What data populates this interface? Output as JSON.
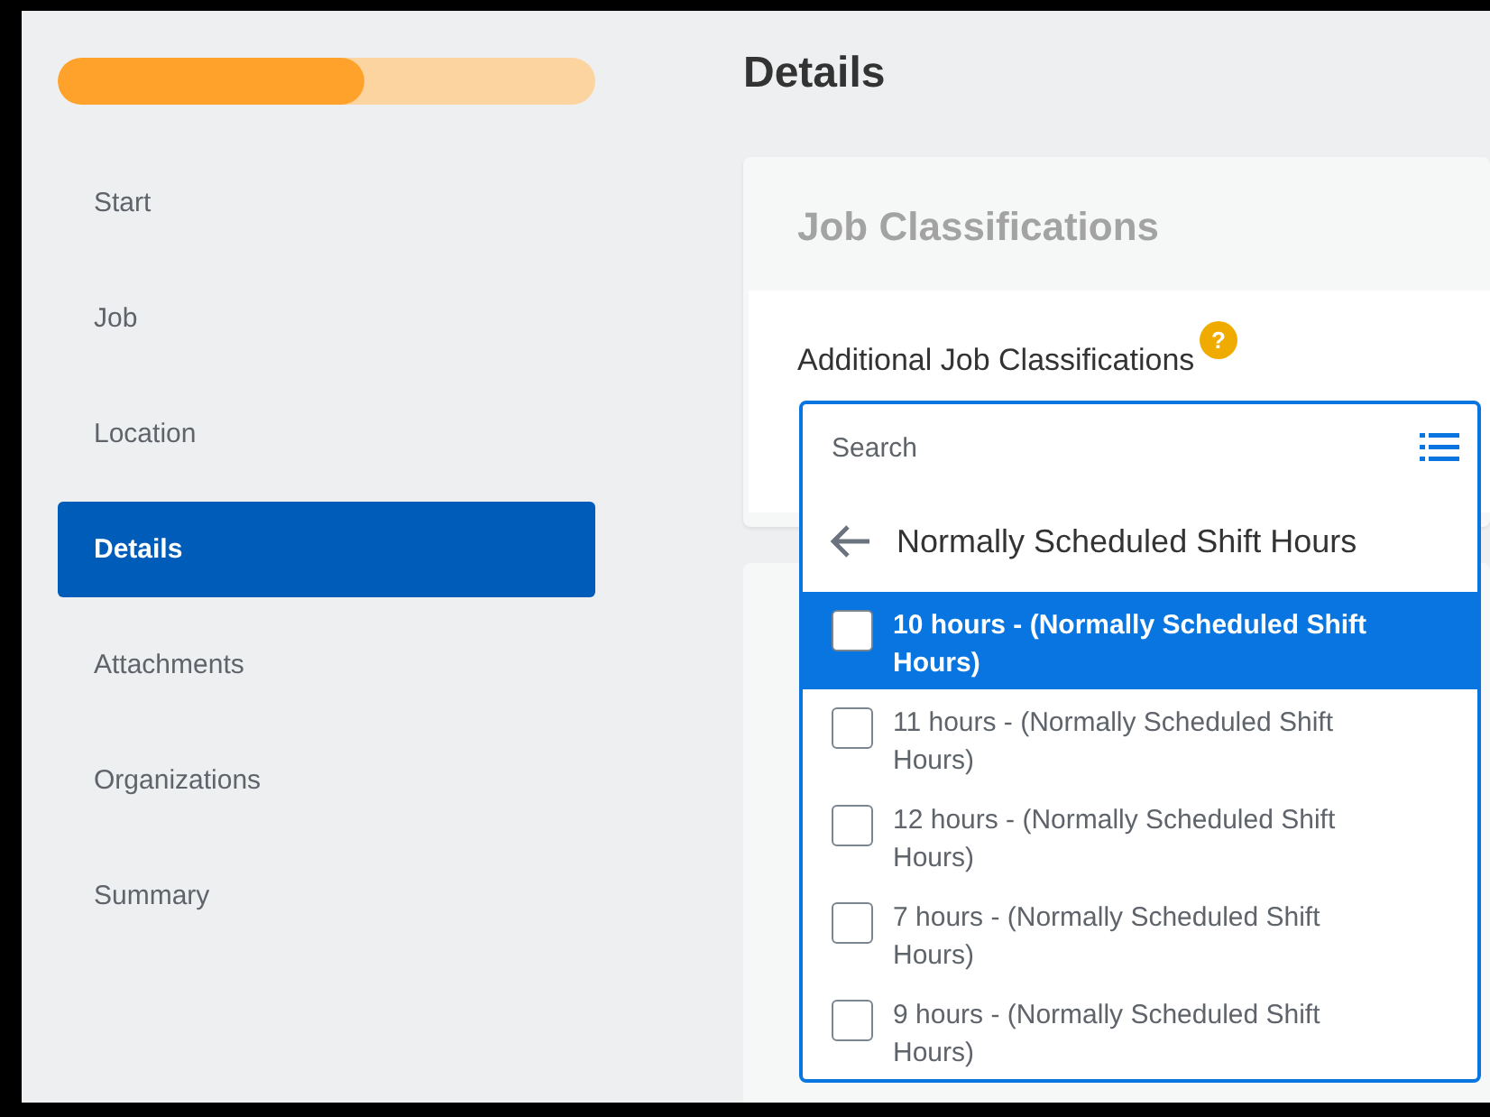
{
  "progress": {
    "level": 0.57
  },
  "steps": [
    {
      "label": "Start",
      "selected": false
    },
    {
      "label": "Job",
      "selected": false
    },
    {
      "label": "Location",
      "selected": false
    },
    {
      "label": "Details",
      "selected": true
    },
    {
      "label": "Attachments",
      "selected": false
    },
    {
      "label": "Organizations",
      "selected": false
    },
    {
      "label": "Summary",
      "selected": false
    }
  ],
  "page_title": "Details",
  "card": {
    "title": "Job Classifications",
    "field_label": "Additional Job Classifications",
    "help": "?"
  },
  "dropdown": {
    "placeholder": "Search",
    "category": "Normally Scheduled Shift Hours",
    "options": [
      {
        "label": "10 hours - (Normally Scheduled Shift Hours)",
        "selected": true,
        "checked": false
      },
      {
        "label": "11 hours - (Normally Scheduled Shift Hours)",
        "selected": false,
        "checked": false
      },
      {
        "label": "12 hours - (Normally Scheduled Shift Hours)",
        "selected": false,
        "checked": false
      },
      {
        "label": "7 hours - (Normally Scheduled Shift Hours)",
        "selected": false,
        "checked": false
      },
      {
        "label": "9 hours - (Normally Scheduled Shift Hours)",
        "selected": false,
        "checked": false
      }
    ]
  }
}
